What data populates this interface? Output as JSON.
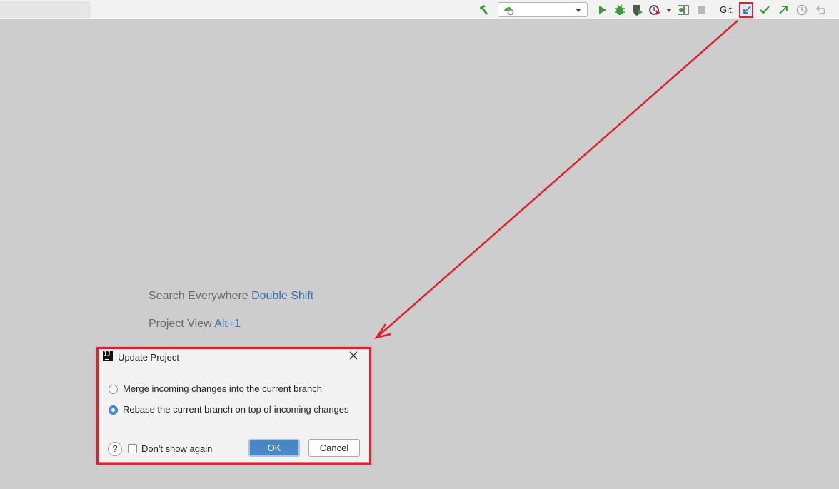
{
  "toolbar": {
    "run_config_value": "",
    "git_label": "Git:",
    "icons": [
      "build-hammer-icon",
      "run-config-icon",
      "dropdown-chevron-icon",
      "run-icon",
      "debug-icon",
      "coverage-icon",
      "profile-icon",
      "more-run-chevron-icon",
      "attach-debugger-icon",
      "stop-icon",
      "git-update-icon",
      "git-commit-icon",
      "git-push-icon",
      "git-history-icon",
      "git-rollback-icon"
    ]
  },
  "hints": {
    "search_label": "Search Everywhere",
    "search_key": "Double Shift",
    "project_label": "Project View",
    "project_key": "Alt+1"
  },
  "dialog": {
    "title": "Update Project",
    "options": [
      {
        "label": "Merge incoming changes into the current branch",
        "selected": false
      },
      {
        "label": "Rebase the current branch on top of incoming changes",
        "selected": true
      }
    ],
    "help_label": "?",
    "dont_show_label": "Don't show again",
    "dont_show_checked": false,
    "ok_label": "OK",
    "cancel_label": "Cancel"
  },
  "colors": {
    "highlight": "#e0202a",
    "accent": "#4a87c7",
    "shortcut": "#3d6fa8",
    "run_green": "#3f9a3f"
  }
}
